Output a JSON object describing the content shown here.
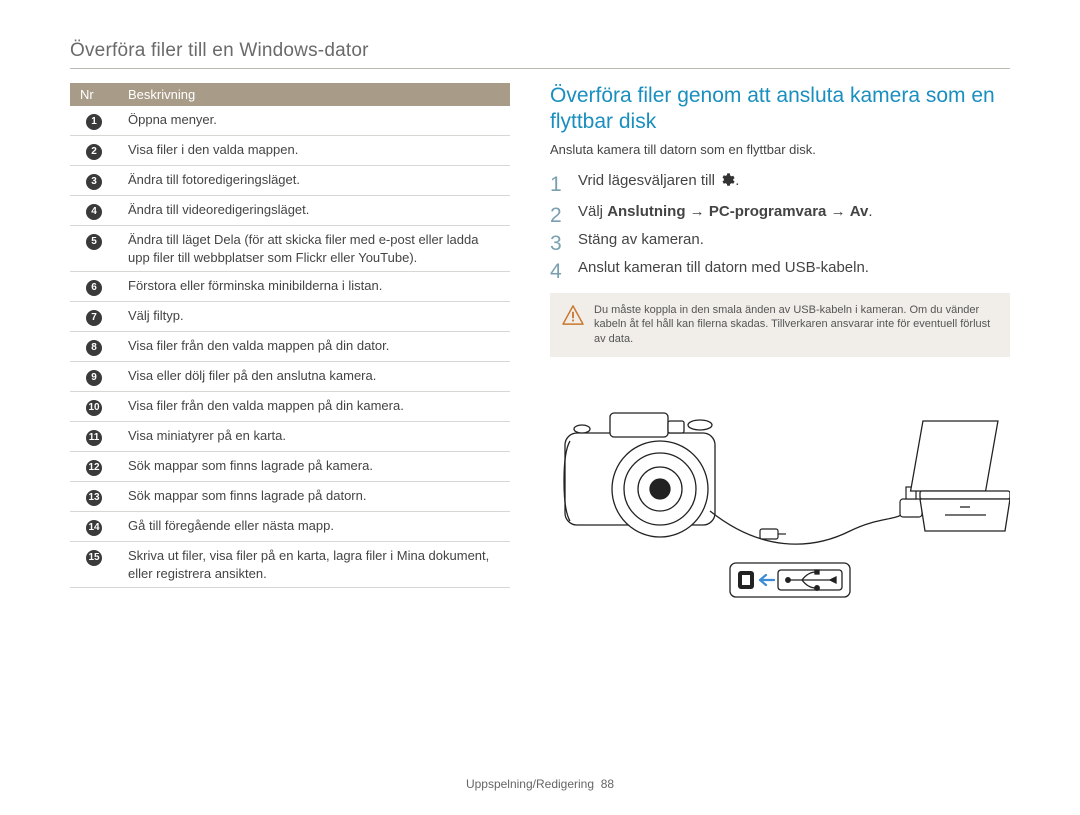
{
  "page_title": "Överföra filer till en Windows-dator",
  "table": {
    "header": {
      "col1": "Nr",
      "col2": "Beskrivning"
    },
    "rows": [
      {
        "num": "1",
        "text": "Öppna menyer."
      },
      {
        "num": "2",
        "text": "Visa filer i den valda mappen."
      },
      {
        "num": "3",
        "text": "Ändra till fotoredigeringsläget."
      },
      {
        "num": "4",
        "text": "Ändra till videoredigeringsläget."
      },
      {
        "num": "5",
        "text": "Ändra till läget Dela (för att skicka filer med e-post eller ladda upp filer till webbplatser som Flickr eller YouTube)."
      },
      {
        "num": "6",
        "text": "Förstora eller förminska minibilderna i listan."
      },
      {
        "num": "7",
        "text": "Välj filtyp."
      },
      {
        "num": "8",
        "text": "Visa filer från den valda mappen på din dator."
      },
      {
        "num": "9",
        "text": "Visa eller dölj filer på den anslutna kamera."
      },
      {
        "num": "10",
        "text": "Visa filer från den valda mappen på din kamera."
      },
      {
        "num": "11",
        "text": "Visa miniatyrer på en karta."
      },
      {
        "num": "12",
        "text": "Sök mappar som finns lagrade på kamera."
      },
      {
        "num": "13",
        "text": "Sök mappar som finns lagrade på datorn."
      },
      {
        "num": "14",
        "text": "Gå till föregående eller nästa mapp."
      },
      {
        "num": "15",
        "text": "Skriva ut filer, visa filer på en karta, lagra filer i Mina dokument, eller registrera ansikten."
      }
    ]
  },
  "section": {
    "heading": "Överföra filer genom att ansluta kamera som en flyttbar disk",
    "subtitle": "Ansluta kamera till datorn som en flyttbar disk.",
    "steps": {
      "s1_pre": "Vrid lägesväljaren till ",
      "s1_post": ".",
      "s2_pre": "Välj ",
      "s2_b1": "Anslutning",
      "s2_arrow": " → ",
      "s2_b2": "PC-programvara",
      "s2_b3": "Av",
      "s2_post": ".",
      "s3": "Stäng av kameran.",
      "s4": "Anslut kameran till datorn med USB-kabeln."
    },
    "warning": "Du måste koppla in den smala änden av USB-kabeln i kameran. Om du vänder kabeln åt fel håll kan filerna skadas. Tillverkaren ansvarar inte för eventuell förlust av data."
  },
  "footer": {
    "label": "Uppspelning/Redigering",
    "page": "88"
  }
}
